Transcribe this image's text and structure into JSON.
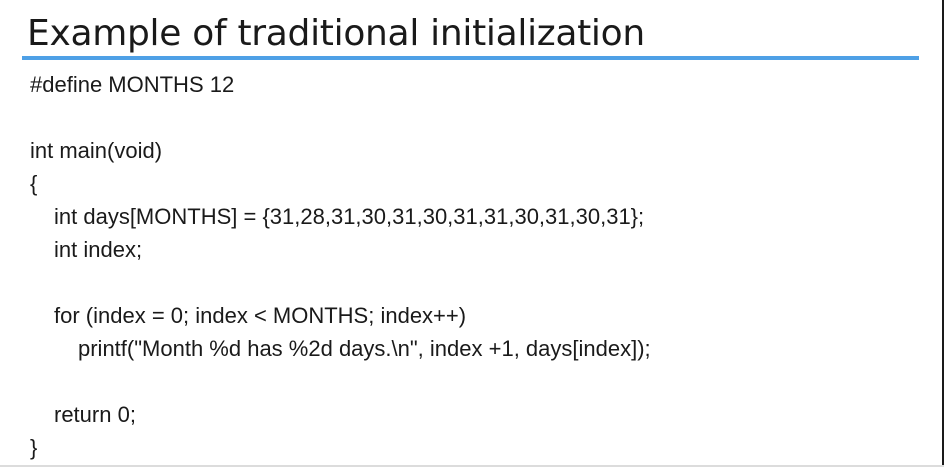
{
  "slide": {
    "title": "Example of traditional initialization",
    "accent_color": "#4ea0e6",
    "code_lines": [
      {
        "text": "#define MONTHS 12",
        "indent": 0
      },
      {
        "text": "",
        "indent": 0
      },
      {
        "text": "int main(void)",
        "indent": 0
      },
      {
        "text": "{",
        "indent": 0
      },
      {
        "text": "int days[MONTHS] = {31,28,31,30,31,30,31,31,30,31,30,31};",
        "indent": 1
      },
      {
        "text": "int index;",
        "indent": 1
      },
      {
        "text": "",
        "indent": 0
      },
      {
        "text": "for (index = 0; index < MONTHS; index++)",
        "indent": 1
      },
      {
        "text": "printf(\"Month %d has %2d days.\\n\", index +1, days[index]);",
        "indent": 2
      },
      {
        "text": "",
        "indent": 0
      },
      {
        "text": "return 0;",
        "indent": 1
      },
      {
        "text": "}",
        "indent": 0
      }
    ]
  }
}
